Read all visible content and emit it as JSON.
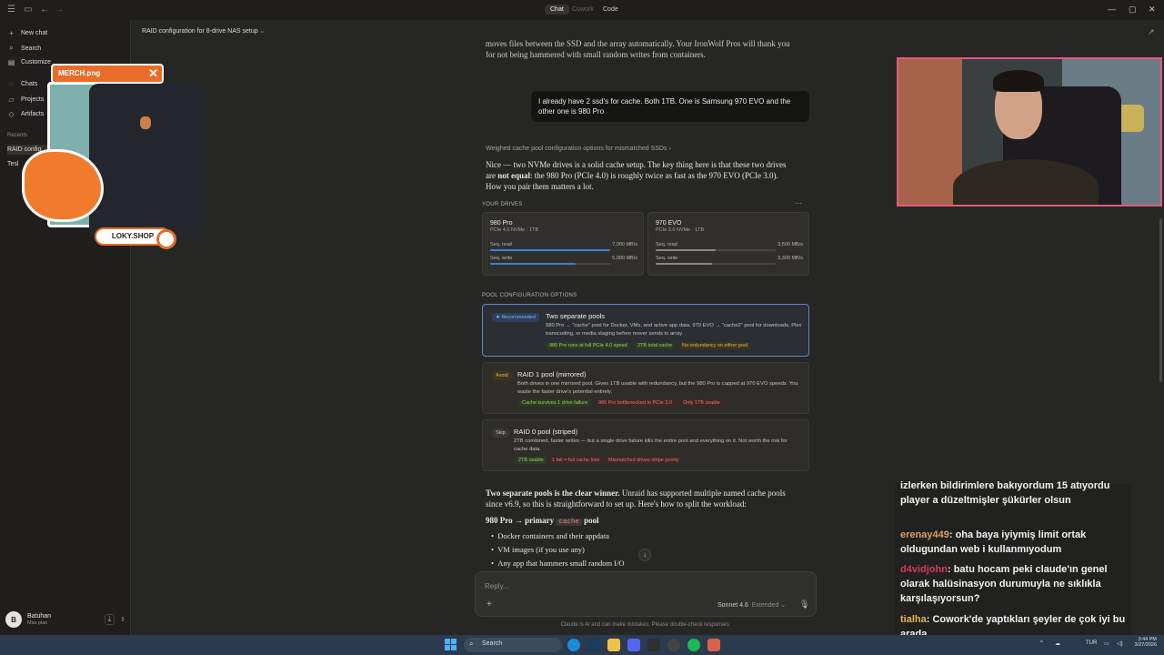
{
  "titlebar": {
    "tabs": [
      "Chat",
      "Cowork",
      "Code"
    ]
  },
  "sidebar": {
    "items": [
      {
        "label": "New chat",
        "icon": "plus-icon"
      },
      {
        "label": "Search",
        "icon": "search-icon"
      },
      {
        "label": "Customize",
        "icon": "customize-icon"
      },
      {
        "label": "Chats",
        "icon": "chat-icon"
      },
      {
        "label": "Projects",
        "icon": "folder-icon"
      },
      {
        "label": "Artifacts",
        "icon": "artifact-icon"
      }
    ],
    "recents_label": "Recents",
    "recents": [
      "RAID config",
      "Tesl"
    ],
    "user": {
      "initial": "B",
      "name": "Batuhan",
      "plan": "Max plan"
    }
  },
  "merch": {
    "brand": "MERCH.png",
    "shop": "LOKY.SHOP"
  },
  "conversation": {
    "title": "RAID configuration for 8-drive NAS setup",
    "prev_text_1": "moves files between the SSD and the array automatically. Your IronWolf Pros will thank you",
    "prev_text_2": "for not being hammered with small random writes from containers.",
    "user_message": "I already have 2 ssd's for cache. Both 1TB. One is Samsung 970 EVO and the other one is  980 Pro",
    "thinking": "Weighed cache pool configuration options for mismatched SSDs",
    "intro_a": "Nice — two NVMe drives is a solid cache setup. The key thing here is that these two drives are ",
    "intro_bold": "not equal",
    "intro_b": ": the 980 Pro (PCIe 4.0) is roughly twice as fast as the 970 EVO (PCIe 3.0). How you pair them matters a lot.",
    "drives_label": "YOUR DRIVES",
    "drives": [
      {
        "name": "980 Pro",
        "sub": "PCIe 4.0 NVMe · 1TB",
        "read_label": "Seq. read",
        "read": "7,000 MB/s",
        "read_frac": 1.0,
        "write_label": "Seq. write",
        "write": "5,000 MB/s",
        "write_frac": 0.71,
        "color": "#3d7fd9"
      },
      {
        "name": "970 EVO",
        "sub": "PCIe 3.0 NVMe · 1TB",
        "read_label": "Seq. read",
        "read": "3,500 MB/s",
        "read_frac": 0.5,
        "write_label": "Seq. write",
        "write": "3,300 MB/s",
        "write_frac": 0.47,
        "color": "#8a8882"
      }
    ],
    "pool_label": "POOL CONFIGURATION OPTIONS",
    "options": [
      {
        "badge": "★ Recommended",
        "title": "Two separate pools",
        "desc": "980 Pro → \"cache\" pool for Docker, VMs, and active app data. 970 EVO → \"cache2\" pool for downloads, Plex transcoding, or media staging before mover sends to array.",
        "tags": [
          {
            "t": "980 Pro runs at full PCIe 4.0 speed",
            "c": "g"
          },
          {
            "t": "2TB total cache",
            "c": "g"
          },
          {
            "t": "No redundancy on either pool",
            "c": "y"
          }
        ]
      },
      {
        "badge": "Avoid",
        "title": "RAID 1 pool (mirrored)",
        "desc": "Both drives in one mirrored pool. Gives 1TB usable with redundancy, but the 980 Pro is capped at 970 EVO speeds. You waste the faster drive's potential entirely.",
        "tags": [
          {
            "t": "Cache survives 1 drive failure",
            "c": "g"
          },
          {
            "t": "980 Pro bottlenecked to PCIe 3.0",
            "c": "r"
          },
          {
            "t": "Only 1TB usable",
            "c": "r"
          }
        ]
      },
      {
        "badge": "Skip",
        "title": "RAID 0 pool (striped)",
        "desc": "2TB combined, faster writes — but a single drive failure kills the entire pool and everything on it. Not worth the risk for cache data.",
        "tags": [
          {
            "t": "2TB usable",
            "c": "g"
          },
          {
            "t": "1 fail = full cache loss",
            "c": "r"
          },
          {
            "t": "Mismatched drives stripe poorly",
            "c": "r"
          }
        ]
      }
    ],
    "winner_bold": "Two separate pools is the clear winner.",
    "winner_rest": " Unraid has supported multiple named cache pools since v6.9, so this is straightforward to set up. Here's how to split the workload:",
    "primary_a": "980 Pro → primary ",
    "primary_code": "cache",
    "primary_b": " pool",
    "bullets": [
      "Docker containers and their appdata",
      "VM images (if you use any)",
      "Any app that hammers small random I/O"
    ],
    "composer_placeholder": "Reply...",
    "model": "Sonnet 4.6",
    "mode": "Extended",
    "disclaimer": "Claude is AI and can make mistakes. Please double-check responses."
  },
  "chat": {
    "messages": [
      {
        "user": "",
        "text": "izlerken bildirimlere bakıyordum 15 atıyordu player a düzeltmişler şükürler olsun",
        "color": "#ffffff"
      },
      {
        "user": "erenay449",
        "text": "oha baya iyiymiş limit ortak oldugundan web i kullanmıyodum",
        "color": "#d9a066"
      },
      {
        "user": "d4vidjohn",
        "text": "batu hocam peki claude'ın genel olarak halüsinasyon durumuyla ne sıklıkla karşılaşıyorsun?",
        "color": "#d23c5a"
      },
      {
        "user": "tialha",
        "text": "Cowork'de yaptıkları şeyler de çok iyi bu arada",
        "color": "#e0b84a"
      }
    ]
  },
  "taskbar": {
    "search": "Search",
    "lang": "TUR",
    "time": "3:44 PM",
    "date": "3/27/2026"
  }
}
